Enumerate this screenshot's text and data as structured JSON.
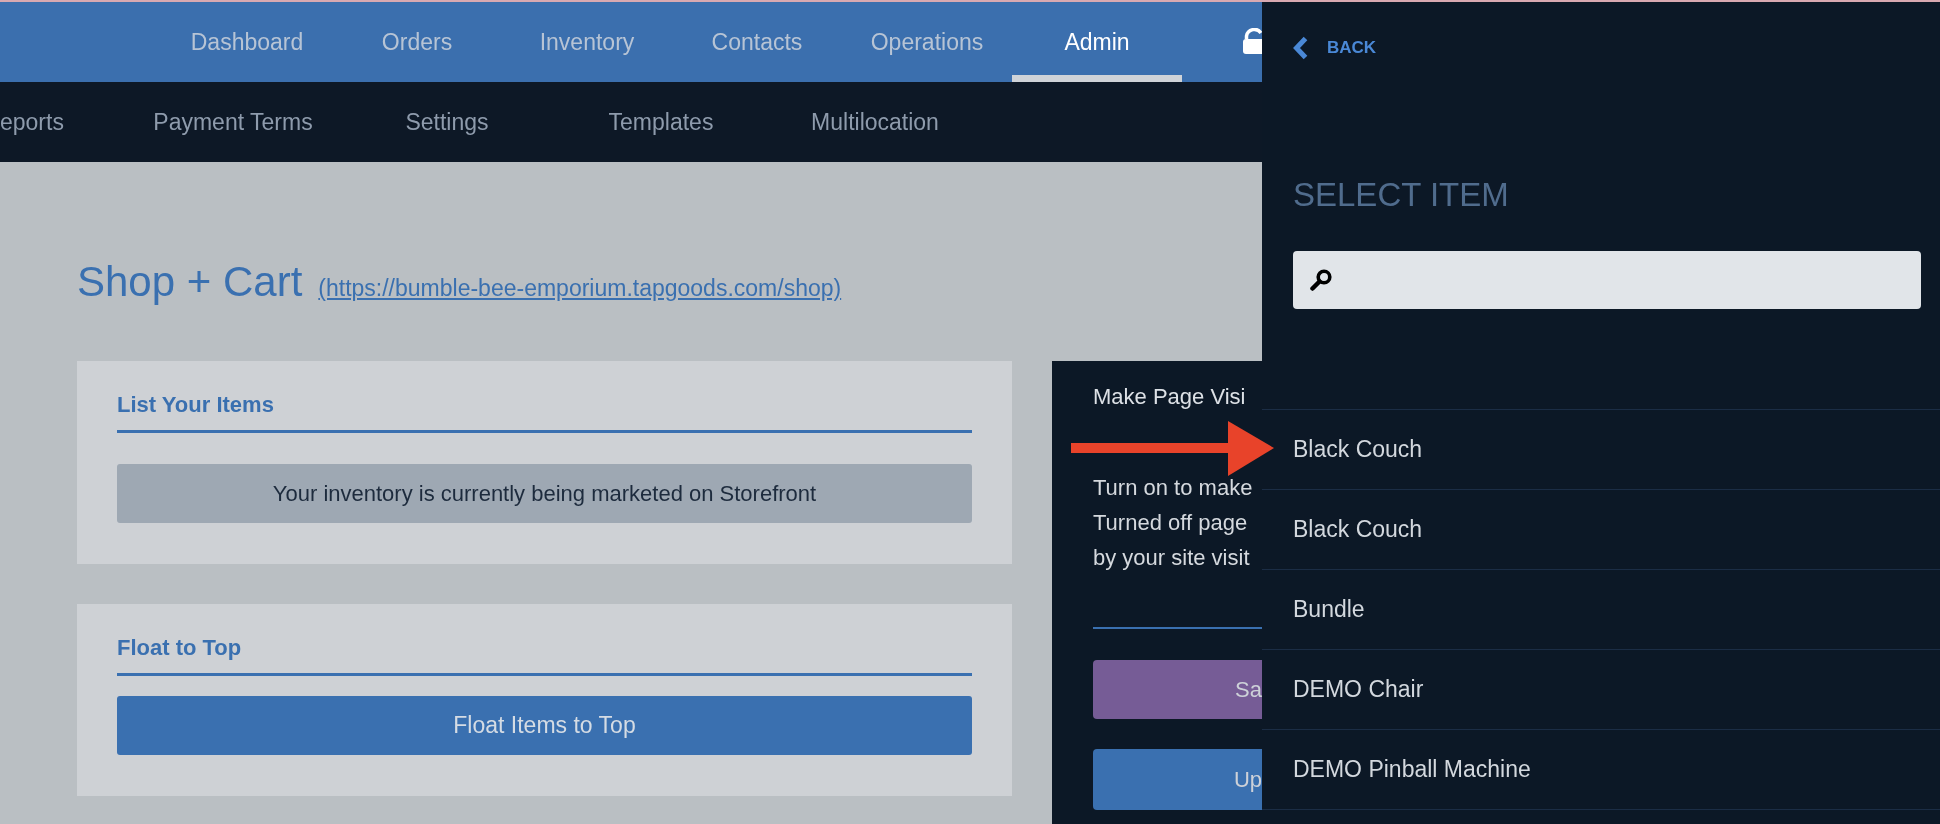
{
  "top_nav": {
    "items": [
      {
        "label": "Dashboard",
        "selected": false
      },
      {
        "label": "Orders",
        "selected": false
      },
      {
        "label": "Inventory",
        "selected": false
      },
      {
        "label": "Contacts",
        "selected": false
      },
      {
        "label": "Operations",
        "selected": false
      },
      {
        "label": "Admin",
        "selected": true
      }
    ]
  },
  "sub_nav": {
    "items": [
      "eports",
      "Payment Terms",
      "Settings",
      "Templates",
      "Multilocation"
    ]
  },
  "page": {
    "title": "Shop + Cart",
    "link": "(https://bumble-bee-emporium.tapgoods.com/shop)"
  },
  "cards": [
    {
      "title": "List Your Items",
      "kind": "notice",
      "text": "Your inventory is currently being marketed on Storefront"
    },
    {
      "title": "Float to Top",
      "kind": "action",
      "text": "Float Items to Top"
    }
  ],
  "visibility_panel": {
    "title": "Make Page Visi",
    "description_lines": [
      "Turn on to make",
      "Turned off page",
      "by your site visit"
    ],
    "buttons": [
      {
        "label": "Sa",
        "kind": "accent"
      },
      {
        "label": "Up",
        "kind": "primary"
      }
    ]
  },
  "item_picker": {
    "back": "BACK",
    "title": "SELECT ITEM",
    "items": [
      "Black Couch",
      "Black Couch",
      "Bundle",
      "DEMO Chair",
      "DEMO Pinball Machine"
    ]
  }
}
